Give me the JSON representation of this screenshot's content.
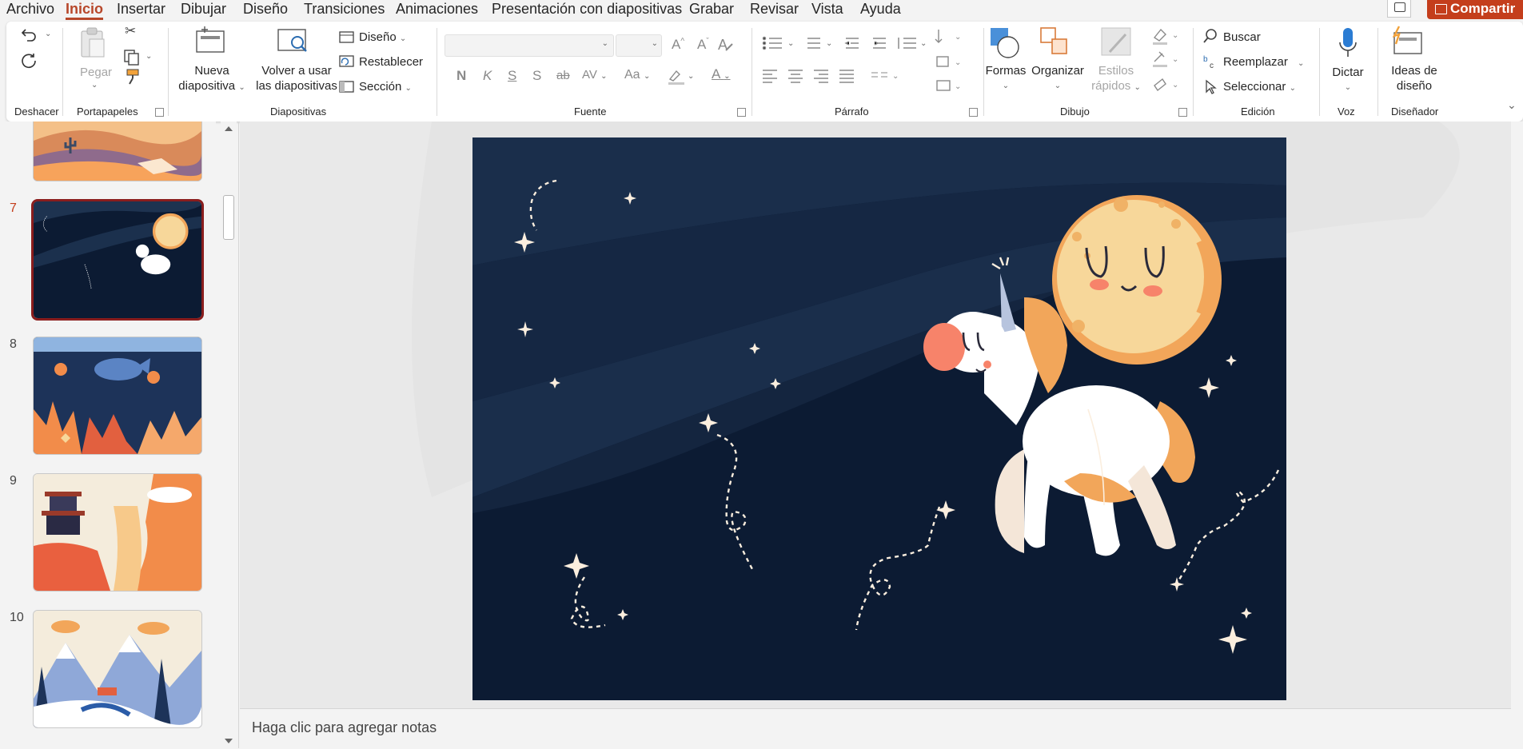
{
  "menu": {
    "tabs": [
      "Archivo",
      "Inicio",
      "Insertar",
      "Dibujar",
      "Diseño",
      "Transiciones",
      "Animaciones",
      "Presentación con diapositivas",
      "Grabar",
      "Revisar",
      "Vista",
      "Ayuda"
    ],
    "active": "Inicio",
    "share_label": "Compartir"
  },
  "ribbon": {
    "groups": {
      "undo": "Deshacer",
      "clipboard": "Portapapeles",
      "slides": "Diapositivas",
      "font": "Fuente",
      "paragraph": "Párrafo",
      "drawing": "Dibujo",
      "editing": "Edición",
      "voice": "Voz",
      "designer": "Diseñador"
    },
    "clipboard": {
      "paste": "Pegar"
    },
    "slides": {
      "new_slide": [
        "Nueva",
        "diapositiva"
      ],
      "reuse": [
        "Volver a usar",
        "las diapositivas"
      ],
      "layout": "Diseño",
      "reset": "Restablecer",
      "section": "Sección"
    },
    "font": {
      "bold": "N",
      "italic": "K",
      "underline": "S",
      "shadow": "S",
      "strike": "ab",
      "spacing": "AV",
      "case": "Aa",
      "grow": "A",
      "shrink": "A",
      "color": "A"
    },
    "drawing": {
      "shapes": "Formas",
      "arrange": "Organizar",
      "quick_styles": [
        "Estilos",
        "rápidos"
      ]
    },
    "editing": {
      "find": "Buscar",
      "replace": "Reemplazar",
      "select": "Seleccionar"
    },
    "voice": {
      "dictate": "Dictar"
    },
    "designer": {
      "ideas": [
        "Ideas de",
        "diseño"
      ]
    }
  },
  "slides": [
    {
      "number": "7",
      "selected": true
    },
    {
      "number": "8",
      "selected": false
    },
    {
      "number": "9",
      "selected": false
    },
    {
      "number": "10",
      "selected": false
    }
  ],
  "notes": {
    "placeholder": "Haga clic para agregar notas"
  },
  "colors": {
    "accent": "#c43e1c",
    "night_sky": "#0c1b33",
    "moon": "#f7d79a",
    "moon_rim": "#f2a65a"
  }
}
